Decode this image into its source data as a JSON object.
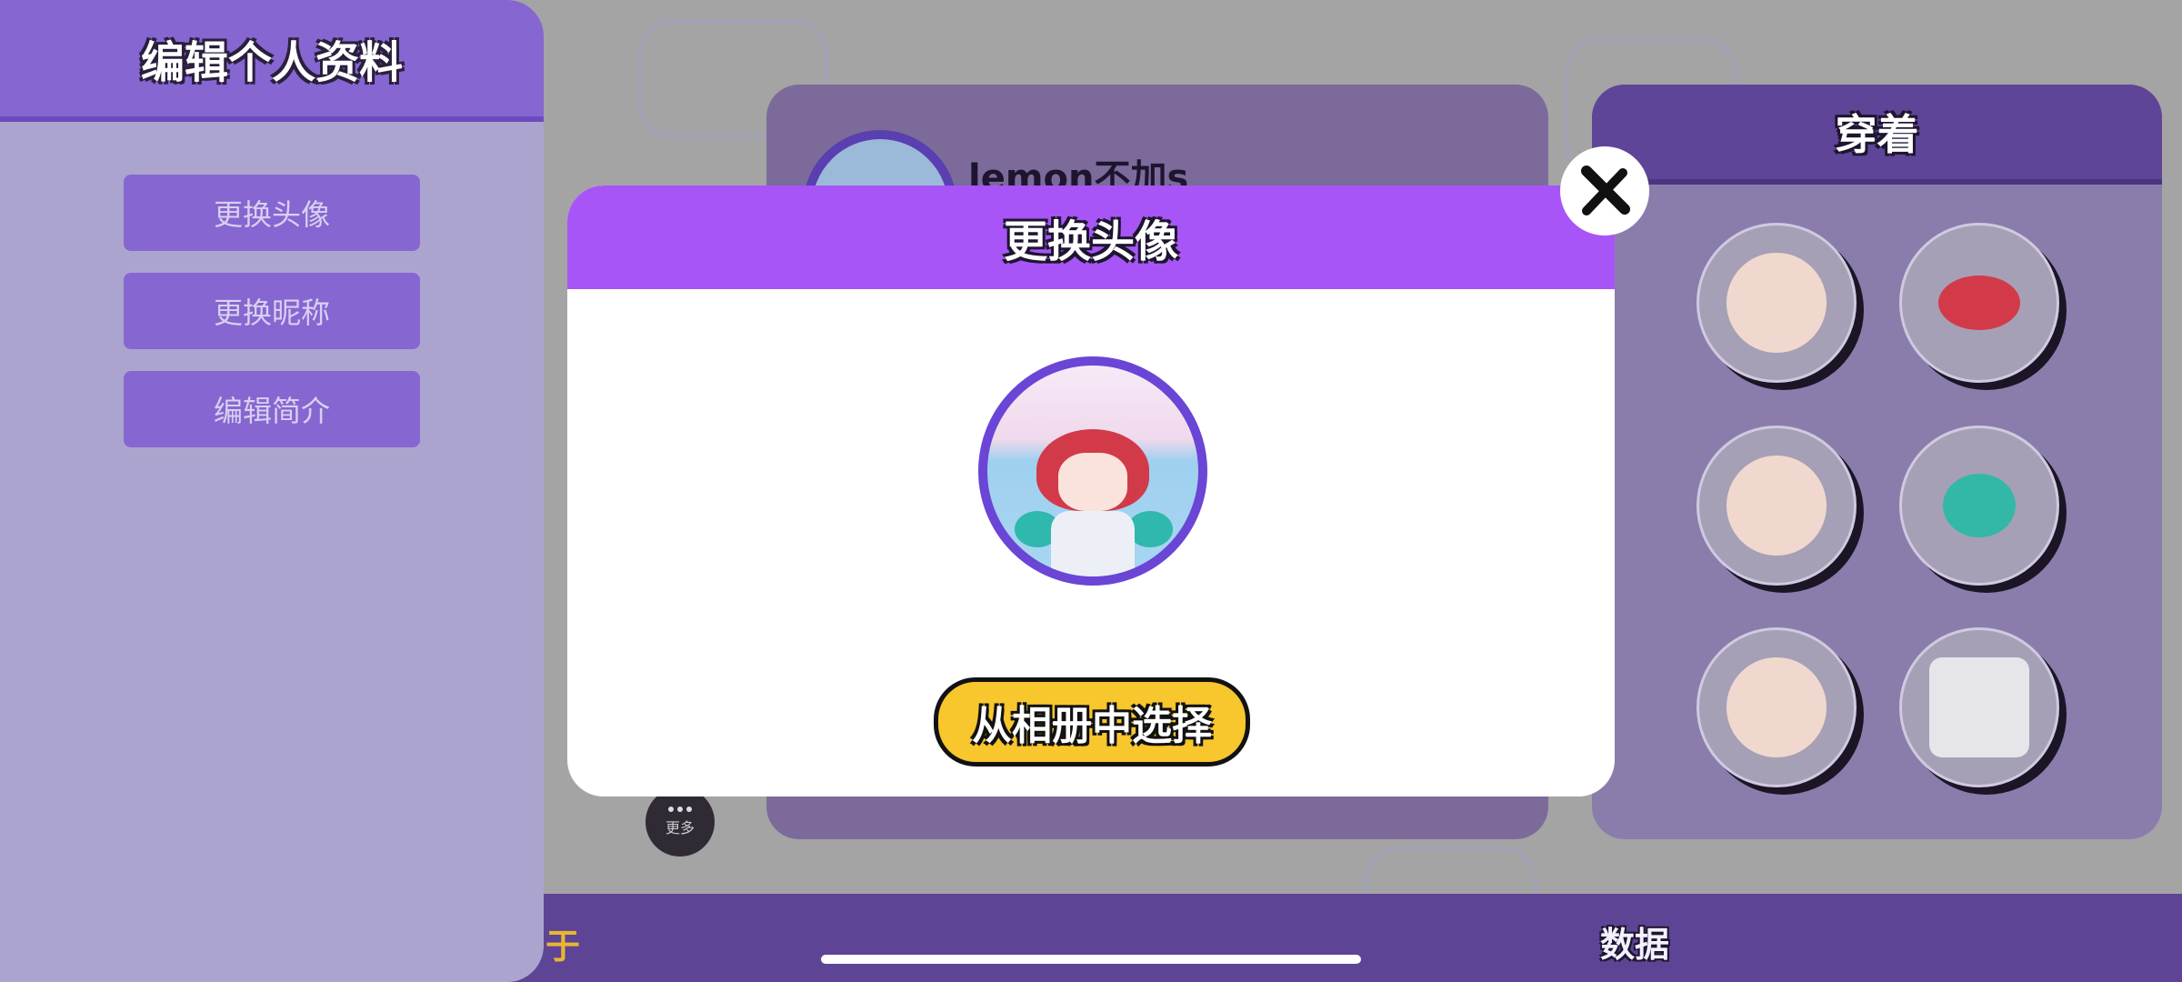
{
  "sidebar": {
    "title": "编辑个人资料",
    "buttons": [
      {
        "label": "更换头像"
      },
      {
        "label": "更换昵称"
      },
      {
        "label": "编辑简介"
      }
    ]
  },
  "profile": {
    "name": "lemon不加s",
    "more_label": "更多"
  },
  "outfit": {
    "title": "穿着",
    "slots": [
      {
        "icon": "eyes-icon"
      },
      {
        "icon": "hair-icon"
      },
      {
        "icon": "head-icon"
      },
      {
        "icon": "accessory-icon"
      },
      {
        "icon": "face-icon"
      },
      {
        "icon": "outfit-icon"
      }
    ]
  },
  "bottom_tabs": {
    "left_partial": "于",
    "right": "数据"
  },
  "modal": {
    "title": "更换头像",
    "choose_button": "从相册中选择",
    "close_icon": "close-icon"
  },
  "colors": {
    "sidebar_header": "#8666d0",
    "modal_header": "#a855f7",
    "choose_button": "#f8c62d",
    "bottom_bar": "#5e4495"
  }
}
